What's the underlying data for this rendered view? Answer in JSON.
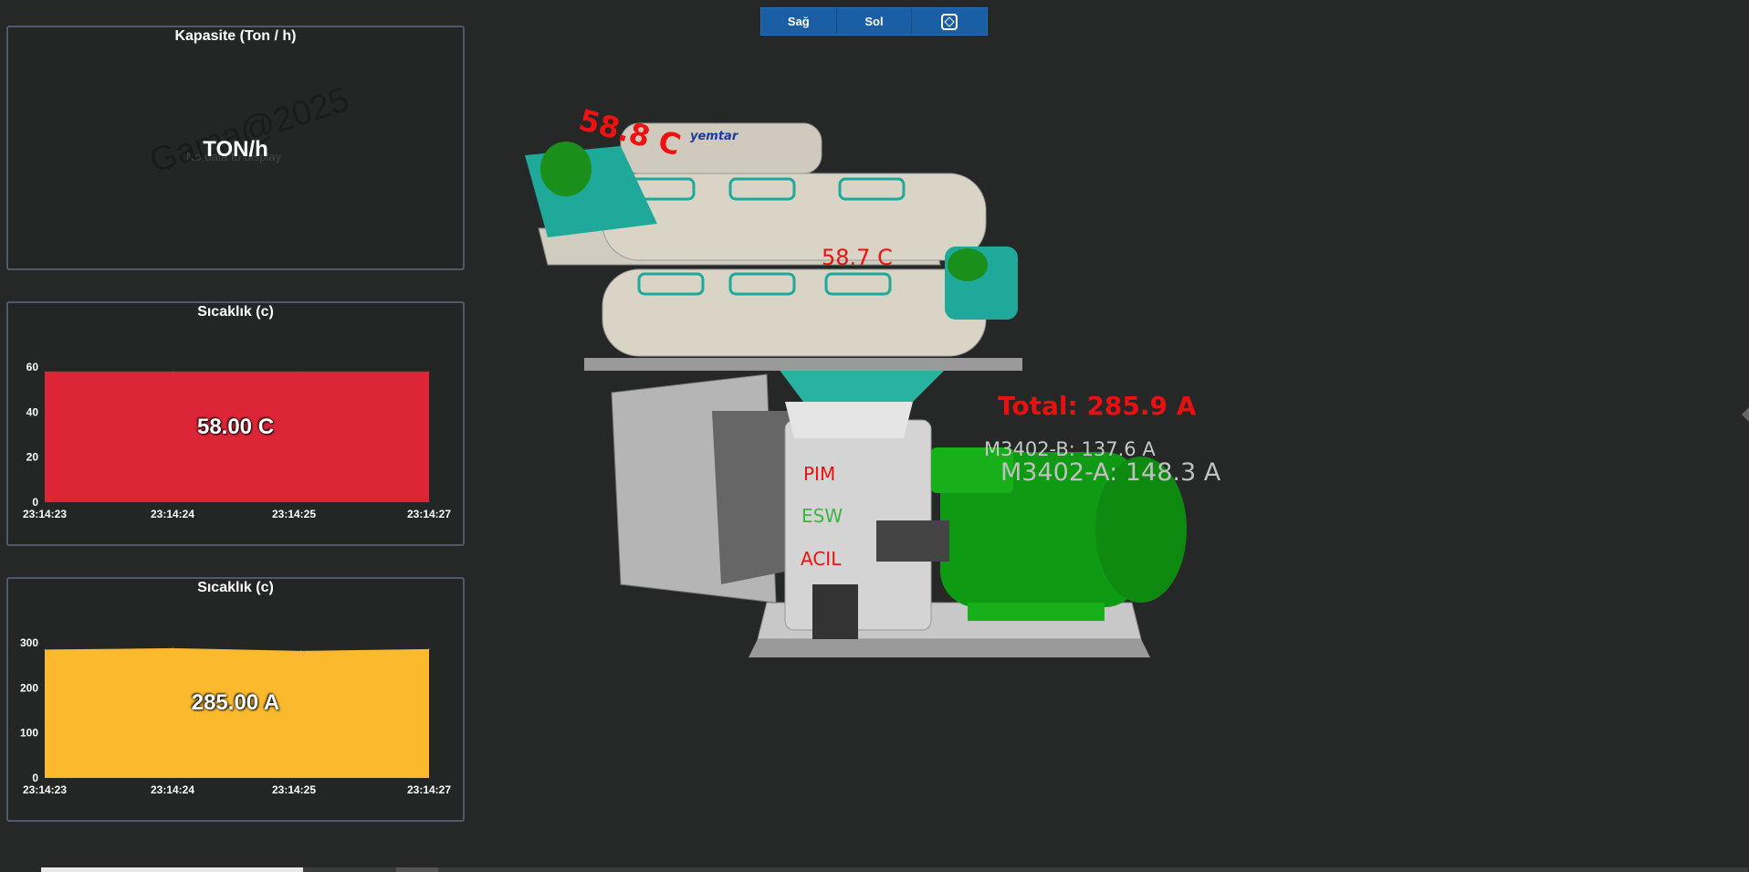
{
  "toolbar": {
    "right_label": "Sağ",
    "left_label": "Sol",
    "view_icon": "cube-icon"
  },
  "capacity_panel": {
    "title": "Kapasite (Ton / h)",
    "unit": "TON/h",
    "no_data": "No data to display",
    "watermark": "Gama@2025"
  },
  "temp_panel": {
    "title": "Sıcaklık (c)",
    "value_label": "58.00 C",
    "color": "#dc2637",
    "chart_data": {
      "type": "area",
      "x": [
        "23:14:23",
        "23:14:24",
        "23:14:25",
        "23:14:27"
      ],
      "values": [
        58,
        58,
        58,
        58
      ],
      "ylim": [
        0,
        60
      ],
      "yticks": [
        0,
        20,
        40,
        60
      ]
    }
  },
  "current_panel": {
    "title": "Sıcaklık (c)",
    "value_label": "285.00 A",
    "color": "#fbb92e",
    "chart_data": {
      "type": "area",
      "x": [
        "23:14:23",
        "23:14:24",
        "23:14:25",
        "23:14:27"
      ],
      "values": [
        285,
        288,
        282,
        286
      ],
      "ylim": [
        0,
        300
      ],
      "yticks": [
        0,
        100,
        200,
        300
      ]
    }
  },
  "machine": {
    "temp_top": "58.8 C",
    "temp_mid": "58.7 C",
    "total_current": "Total: 285.9 A",
    "motor_b": "M3402-B: 137.6 A",
    "motor_a": "M3402-A: 148.3 A",
    "status_pim": "PIM",
    "status_esw": "ESW",
    "status_acil": "ACIL",
    "brand": "yemtar"
  }
}
